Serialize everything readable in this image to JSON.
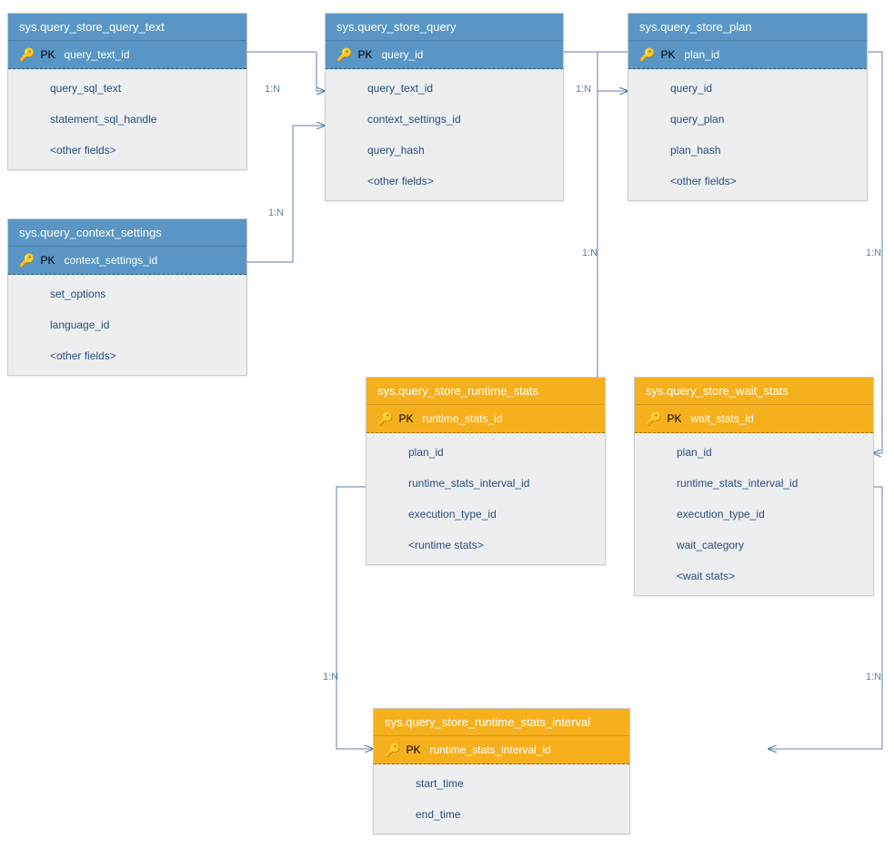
{
  "labels": {
    "pk": "PK",
    "rel_1n": "1:N"
  },
  "entities": {
    "query_text": {
      "title": "sys.query_store_query_text",
      "pk_field": "query_text_id",
      "fields": [
        "query_sql_text",
        "statement_sql_handle",
        "<other fields>"
      ]
    },
    "query": {
      "title": "sys.query_store_query",
      "pk_field": "query_id",
      "fields": [
        "query_text_id",
        "context_settings_id",
        "query_hash",
        "<other fields>"
      ]
    },
    "plan": {
      "title": "sys.query_store_plan",
      "pk_field": "plan_id",
      "fields": [
        "query_id",
        "query_plan",
        "plan_hash",
        "<other fields>"
      ]
    },
    "context_settings": {
      "title": "sys.query_context_settings",
      "pk_field": "context_settings_id",
      "fields": [
        "set_options",
        "language_id",
        "<other fields>"
      ]
    },
    "runtime_stats": {
      "title": "sys.query_store_runtime_stats",
      "pk_field": "runtime_stats_id",
      "fields": [
        "plan_id",
        "runtime_stats_interval_id",
        "execution_type_id",
        "<runtime stats>"
      ]
    },
    "wait_stats": {
      "title": "sys.query_store_wait_stats",
      "pk_field": "wait_stats_id",
      "fields": [
        "plan_id",
        "runtime_stats_interval_id",
        "execution_type_id",
        "wait_category",
        "<wait stats>"
      ]
    },
    "interval": {
      "title": "sys.query_store_runtime_stats_interval",
      "pk_field": "runtime_stats_interval_id",
      "fields": [
        "start_time",
        "end_time"
      ]
    }
  }
}
